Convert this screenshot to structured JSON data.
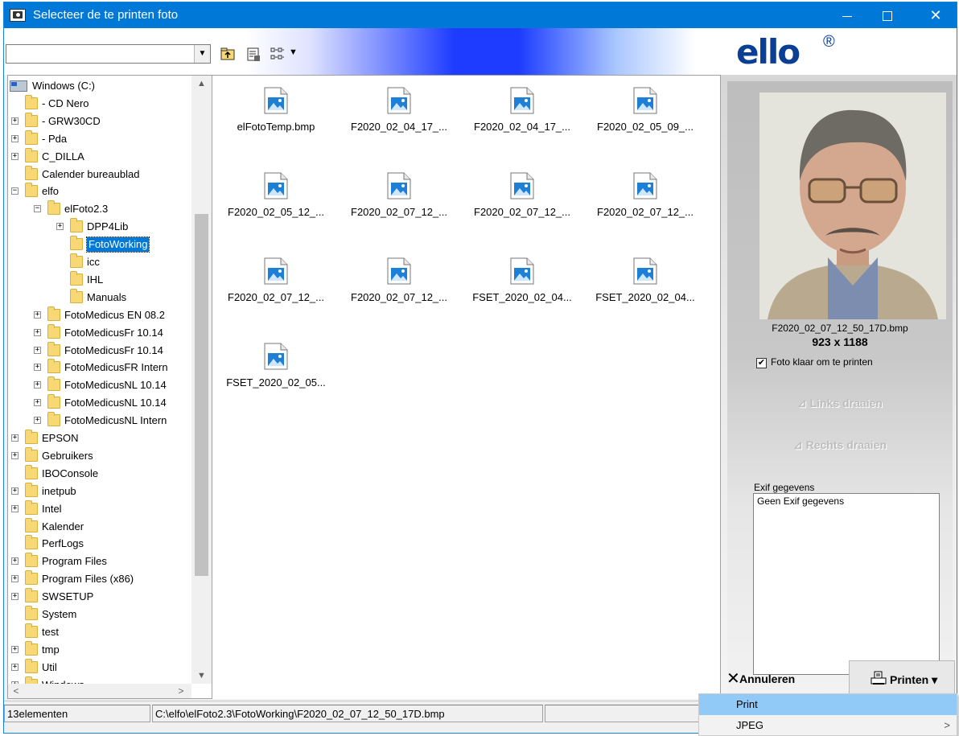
{
  "window": {
    "title": "Selecteer de te printen foto",
    "controls": {
      "minimize": "",
      "maximize": "",
      "close": "✕"
    },
    "accent": "#0078d7"
  },
  "toolbar": {
    "path_value": "",
    "logo_text": "ello",
    "logo_mark": "®",
    "icons": [
      "up-folder-icon",
      "properties-icon",
      "view-icon",
      "chevron-down-icon"
    ]
  },
  "tree": {
    "items": [
      {
        "label": "Windows (C:)",
        "expander": ""
      },
      {
        "label": "- CD  Nero",
        "expander": ""
      },
      {
        "label": "- GRW30CD",
        "expander": "+"
      },
      {
        "label": "- Pda",
        "expander": "+"
      },
      {
        "label": "C_DILLA",
        "expander": "+"
      },
      {
        "label": "Calender bureaublad",
        "expander": ""
      },
      {
        "label": "elfo",
        "expander": "−"
      },
      {
        "label": "elFoto2.3",
        "expander": "−"
      },
      {
        "label": "DPP4Lib",
        "expander": "+"
      },
      {
        "label": "FotoWorking",
        "expander": ""
      },
      {
        "label": "icc",
        "expander": ""
      },
      {
        "label": "IHL",
        "expander": ""
      },
      {
        "label": "Manuals",
        "expander": ""
      },
      {
        "label": "FotoMedicus EN 08.2",
        "expander": "+"
      },
      {
        "label": "FotoMedicusFr 10.14",
        "expander": "+"
      },
      {
        "label": "FotoMedicusFr 10.14",
        "expander": "+"
      },
      {
        "label": "FotoMedicusFR Intern",
        "expander": "+"
      },
      {
        "label": "FotoMedicusNL 10.14",
        "expander": "+"
      },
      {
        "label": "FotoMedicusNL 10.14",
        "expander": "+"
      },
      {
        "label": "FotoMedicusNL Intern",
        "expander": "+"
      },
      {
        "label": "EPSON",
        "expander": "+"
      },
      {
        "label": "Gebruikers",
        "expander": "+"
      },
      {
        "label": "IBOConsole",
        "expander": ""
      },
      {
        "label": "inetpub",
        "expander": "+"
      },
      {
        "label": "Intel",
        "expander": "+"
      },
      {
        "label": "Kalender",
        "expander": ""
      },
      {
        "label": "PerfLogs",
        "expander": ""
      },
      {
        "label": "Program Files",
        "expander": "+"
      },
      {
        "label": "Program Files (x86)",
        "expander": "+"
      },
      {
        "label": "SWSETUP",
        "expander": "+"
      },
      {
        "label": "System",
        "expander": ""
      },
      {
        "label": "test",
        "expander": ""
      },
      {
        "label": "tmp",
        "expander": "+"
      },
      {
        "label": "Util",
        "expander": "+"
      },
      {
        "label": "Windows",
        "expander": "+"
      }
    ],
    "selected": "FotoWorking",
    "scroll_up": "▲",
    "scroll_down": "▼",
    "scroll_left": "<",
    "scroll_right": ">"
  },
  "files": [
    "elFotoTemp.bmp",
    "F2020_02_04_17_...",
    "F2020_02_04_17_...",
    "F2020_02_05_09_...",
    "F2020_02_05_12_...",
    "F2020_02_07_12_...",
    "F2020_02_07_12_...",
    "F2020_02_07_12_...",
    "F2020_02_07_12_...",
    "F2020_02_07_12_...",
    "FSET_2020_02_04...",
    "FSET_2020_02_04...",
    "FSET_2020_02_05..."
  ],
  "preview": {
    "filename": "F2020_02_07_12_50_17D.bmp",
    "dimensions": "923 x 1188",
    "ready_checked": true,
    "ready_label": "Foto klaar om te printen",
    "rotate_left": "Links draaien",
    "rotate_right": "Rechts draaien",
    "exif_label": "Exif gegevens",
    "exif_value": "Geen Exif gegevens"
  },
  "actions": {
    "cancel": "Annuleren",
    "print": "Printen"
  },
  "status": {
    "count": "13elementen",
    "path": "C:\\elfo\\elFoto2.3\\FotoWorking\\F2020_02_07_12_50_17D.bmp"
  },
  "menu": {
    "items": [
      {
        "label": "Print",
        "highlighted": true,
        "submenu": ""
      },
      {
        "label": "JPEG",
        "highlighted": false,
        "submenu": ">"
      }
    ]
  }
}
